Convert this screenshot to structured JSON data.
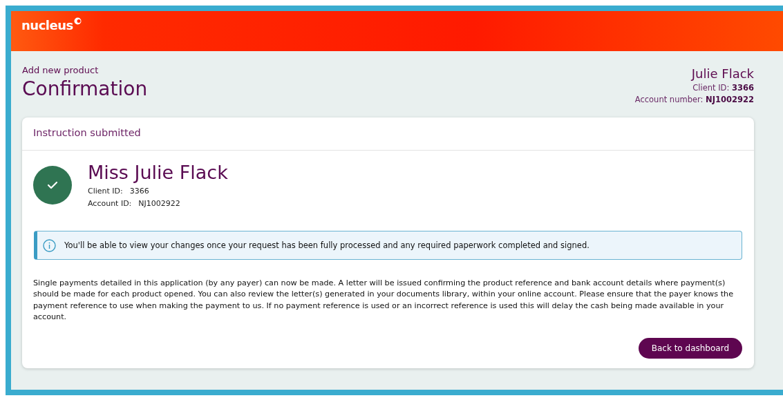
{
  "header": {
    "logo": "nucleus"
  },
  "page": {
    "breadcrumb": "Add new product",
    "title": "Confirmation"
  },
  "client_summary": {
    "name": "Julie Flack",
    "fields": [
      {
        "label": "Client ID:",
        "value": "3366"
      },
      {
        "label": "Account number:",
        "value": "NJ1002922"
      }
    ]
  },
  "card": {
    "title": "Instruction submitted",
    "kind": "success",
    "name": "Miss Julie Flack",
    "fields": [
      {
        "label": "Client ID:",
        "value": "3366"
      },
      {
        "label": "Account ID:",
        "value": "NJ1002922"
      }
    ],
    "alert": {
      "kind": "info",
      "text": "You'll be able to view your changes once your request has been fully processed and any required paperwork completed and signed."
    },
    "body": "Single payments detailed in this application (by any payer) can now be made. A letter will be issued confirming the product reference and bank account details where payment(s) should be made for each product opened. You can also review the letter(s) generated in your documents library, within your online account. Please ensure that the payer knows the payment reference to use when making the payment to us. If no payment reference is used or an incorrect reference is used this will delay the cash being made available in your account.",
    "button": "Back to dashboard"
  }
}
